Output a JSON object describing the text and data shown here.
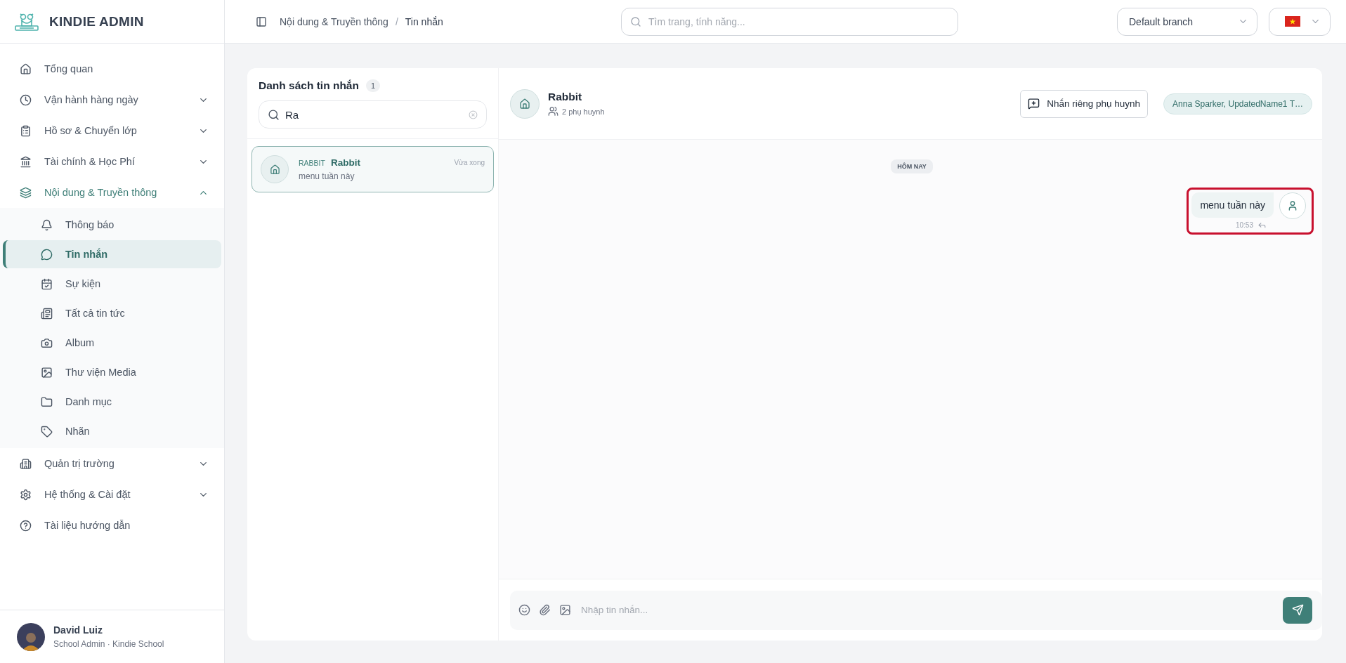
{
  "brand": {
    "name": "KINDIE ADMIN"
  },
  "sidebar": {
    "items": [
      {
        "label": "Tổng quan"
      },
      {
        "label": "Vận hành hàng ngày",
        "expanded": false
      },
      {
        "label": "Hồ sơ & Chuyển lớp",
        "expanded": false
      },
      {
        "label": "Tài chính & Học Phí",
        "expanded": false
      },
      {
        "label": "Nội dung & Truyền thông",
        "expanded": true,
        "children": [
          {
            "label": "Thông báo",
            "selected": false
          },
          {
            "label": "Tin nhắn",
            "selected": true
          },
          {
            "label": "Sự kiện",
            "selected": false
          },
          {
            "label": "Tất cả tin tức",
            "selected": false
          },
          {
            "label": "Album",
            "selected": false
          },
          {
            "label": "Thư viện Media",
            "selected": false
          },
          {
            "label": "Danh mục",
            "selected": false
          },
          {
            "label": "Nhãn",
            "selected": false
          }
        ]
      },
      {
        "label": "Quản trị trường",
        "expanded": false
      },
      {
        "label": "Hệ thống & Cài đặt",
        "expanded": false
      },
      {
        "label": "Tài liệu hướng dẫn"
      }
    ]
  },
  "user": {
    "name": "David Luiz",
    "role": "School Admin · Kindie School"
  },
  "header": {
    "breadcrumb": [
      "Nội dung & Truyền thông",
      "Tin nhắn"
    ],
    "separator": "/",
    "search": {
      "placeholder": "Tìm trang, tính năng..."
    },
    "branch": "Default branch"
  },
  "conversations": {
    "title": "Danh sách tin nhắn",
    "count": "1",
    "search": {
      "value": "Ra"
    },
    "items": [
      {
        "code": "RABBIT",
        "name": "Rabbit",
        "preview": "menu tuần này",
        "time": "Vừa xong",
        "selected": true
      }
    ]
  },
  "chat": {
    "title": "Rabbit",
    "members": "2 phụ huynh",
    "private_button": "Nhắn riêng phụ huynh",
    "recipients": "Anna Sparker, UpdatedName1 T…",
    "day_label": "HÔM NAY",
    "messages": [
      {
        "text": "menu tuần này",
        "time": "10:53",
        "highlighted": true
      }
    ],
    "composer": {
      "placeholder": "Nhập tin nhắn..."
    }
  }
}
